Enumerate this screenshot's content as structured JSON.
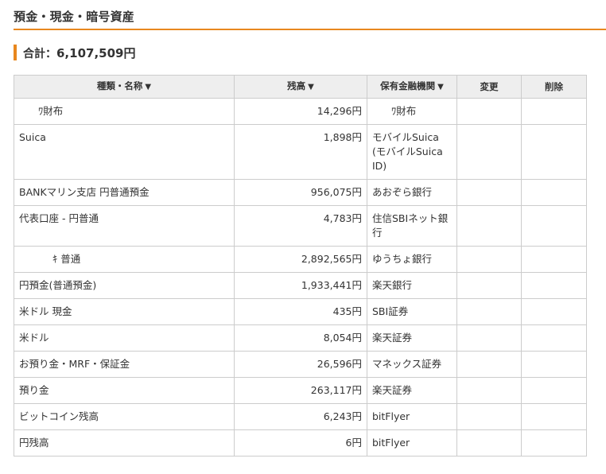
{
  "page_title": "預金・現金・暗号資産",
  "total": {
    "label": "合計：",
    "value": "6,107,509円"
  },
  "accent_color": "#e8871e",
  "table": {
    "headers": {
      "name": "種類・名称",
      "balance": "残高",
      "institution": "保有金融機関",
      "edit": "変更",
      "delete": "削除"
    },
    "sort_indicator": "▼",
    "rows": [
      {
        "name": "ﾜ財布",
        "balance": "14,296円",
        "institution": "ﾜ財布"
      },
      {
        "name": "Suica",
        "balance": "1,898円",
        "institution": "モバイルSuica (モバイルSuica ID)"
      },
      {
        "name": "BANKマリン支店 円普通預金",
        "balance": "956,075円",
        "institution": "あおぞら銀行"
      },
      {
        "name": "代表口座 - 円普通",
        "balance": "4,783円",
        "institution": "住信SBIネット銀行"
      },
      {
        "name": "ｷ 普通",
        "balance": "2,892,565円",
        "institution": "ゆうちょ銀行"
      },
      {
        "name": "円預金(普通預金)",
        "balance": "1,933,441円",
        "institution": "楽天銀行"
      },
      {
        "name": "米ドル 現金",
        "balance": "435円",
        "institution": "SBI証券"
      },
      {
        "name": "米ドル",
        "balance": "8,054円",
        "institution": "楽天証券"
      },
      {
        "name": "お預り金・MRF・保証金",
        "balance": "26,596円",
        "institution": "マネックス証券"
      },
      {
        "name": "預り金",
        "balance": "263,117円",
        "institution": "楽天証券"
      },
      {
        "name": "ビットコイン残高",
        "balance": "6,243円",
        "institution": "bitFlyer"
      },
      {
        "name": "円残高",
        "balance": "6円",
        "institution": "bitFlyer"
      }
    ]
  }
}
